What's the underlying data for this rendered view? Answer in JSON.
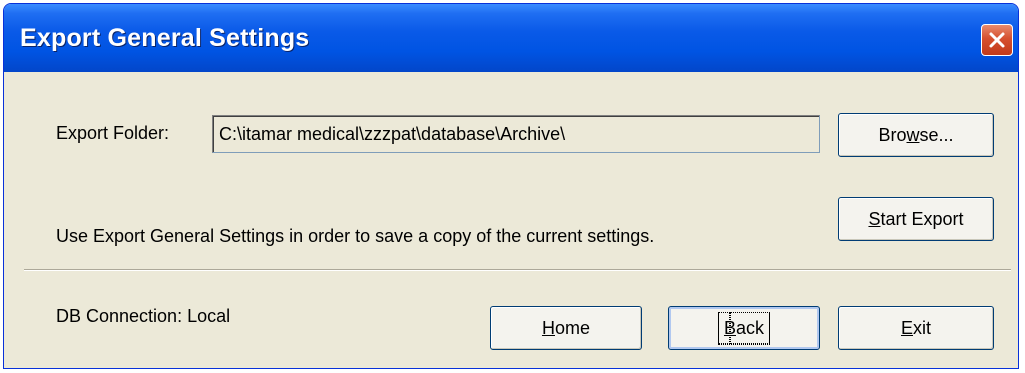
{
  "window": {
    "title": "Export General Settings"
  },
  "export_folder": {
    "label": "Export Folder:",
    "value": "C:\\itamar medical\\zzzpat\\database\\Archive\\"
  },
  "buttons": {
    "browse": {
      "pre": "Bro",
      "accel": "w",
      "post": "se..."
    },
    "start_export": {
      "pre": "",
      "accel": "S",
      "post": "tart Export"
    },
    "home": {
      "pre": "",
      "accel": "H",
      "post": "ome"
    },
    "back": {
      "pre": "",
      "accel": "B",
      "post": "ack"
    },
    "exit": {
      "pre": "",
      "accel": "E",
      "post": "xit"
    }
  },
  "description": "Use Export General Settings in order to save a copy of the current settings.",
  "db_connection": "DB Connection: Local",
  "icons": {
    "close": "close-x-icon"
  },
  "colors": {
    "titlebar": "#0054e3",
    "close_button": "#d6502f",
    "dialog_bg": "#ece9d8"
  }
}
